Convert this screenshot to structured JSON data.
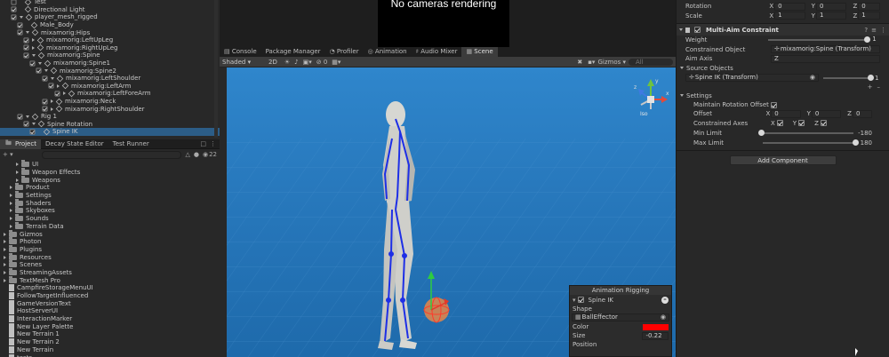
{
  "hierarchy": {
    "items": [
      {
        "label": "Test",
        "indent": 0,
        "check": false,
        "icon": "cube",
        "expand": "none"
      },
      {
        "label": "Directional Light",
        "indent": 0,
        "check": true,
        "icon": "cube",
        "expand": "none"
      },
      {
        "label": "player_mesh_rigged",
        "indent": 0,
        "check": true,
        "icon": "cube",
        "expand": "down"
      },
      {
        "label": "Male_Body",
        "indent": 1,
        "check": true,
        "icon": "cube",
        "expand": "none"
      },
      {
        "label": "mixamorig:Hips",
        "indent": 1,
        "check": true,
        "icon": "cube",
        "expand": "down"
      },
      {
        "label": "mixamorig:LeftUpLeg",
        "indent": 2,
        "check": true,
        "icon": "cube",
        "expand": "right"
      },
      {
        "label": "mixamorig:RightUpLeg",
        "indent": 2,
        "check": true,
        "icon": "cube",
        "expand": "right"
      },
      {
        "label": "mixamorig:Spine",
        "indent": 2,
        "check": true,
        "icon": "cube",
        "expand": "down"
      },
      {
        "label": "mixamorig:Spine1",
        "indent": 3,
        "check": true,
        "icon": "cube",
        "expand": "down"
      },
      {
        "label": "mixamorig:Spine2",
        "indent": 4,
        "check": true,
        "icon": "cube",
        "expand": "down"
      },
      {
        "label": "mixamorig:LeftShoulder",
        "indent": 5,
        "check": true,
        "icon": "cube",
        "expand": "down"
      },
      {
        "label": "mixamorig:LeftArm",
        "indent": 6,
        "check": true,
        "icon": "cube",
        "expand": "right"
      },
      {
        "label": "mixamorig:LeftForeArm",
        "indent": 7,
        "check": true,
        "icon": "cube",
        "expand": "right"
      },
      {
        "label": "mixamorig:Neck",
        "indent": 5,
        "check": true,
        "icon": "cube",
        "expand": "right"
      },
      {
        "label": "mixamorig:RightShoulder",
        "indent": 5,
        "check": true,
        "icon": "cube",
        "expand": "right"
      },
      {
        "label": "Rig 1",
        "indent": 1,
        "check": true,
        "icon": "cube",
        "expand": "down"
      },
      {
        "label": "Spine Rotation",
        "indent": 2,
        "check": true,
        "icon": "cube",
        "expand": "down"
      },
      {
        "label": "Spine IK",
        "indent": 3,
        "check": true,
        "icon": "cube",
        "expand": "none",
        "selected": true
      }
    ]
  },
  "project": {
    "tabs": [
      "Project",
      "Decay State Editor",
      "Test Runner"
    ],
    "count": "22",
    "items": [
      {
        "label": "UI",
        "indent": 1,
        "type": "folder"
      },
      {
        "label": "Weapon Effects",
        "indent": 1,
        "type": "folder"
      },
      {
        "label": "Weapons",
        "indent": 1,
        "type": "folder"
      },
      {
        "label": "Product",
        "indent": 0,
        "type": "folder"
      },
      {
        "label": "Settings",
        "indent": 0,
        "type": "folder"
      },
      {
        "label": "Shaders",
        "indent": 0,
        "type": "folder"
      },
      {
        "label": "Skyboxes",
        "indent": 0,
        "type": "folder"
      },
      {
        "label": "Sounds",
        "indent": 0,
        "type": "folder"
      },
      {
        "label": "Terrain Data",
        "indent": 0,
        "type": "folder"
      },
      {
        "label": "Gizmos",
        "indent": -1,
        "type": "folder"
      },
      {
        "label": "Photon",
        "indent": -1,
        "type": "folder"
      },
      {
        "label": "Plugins",
        "indent": -1,
        "type": "folder"
      },
      {
        "label": "Resources",
        "indent": -1,
        "type": "folder"
      },
      {
        "label": "Scenes",
        "indent": -1,
        "type": "folder"
      },
      {
        "label": "StreamingAssets",
        "indent": -1,
        "type": "folder"
      },
      {
        "label": "TextMesh Pro",
        "indent": -1,
        "type": "folder"
      },
      {
        "label": "CampfireStorageMenuUI",
        "indent": -1,
        "type": "file"
      },
      {
        "label": "FollowTargetInfluenced",
        "indent": -1,
        "type": "file"
      },
      {
        "label": "GameVersionText",
        "indent": -1,
        "type": "file"
      },
      {
        "label": "HostServerUI",
        "indent": -1,
        "type": "file"
      },
      {
        "label": "InteractionMarker",
        "indent": -1,
        "type": "file"
      },
      {
        "label": "New Layer Palette",
        "indent": -1,
        "type": "file"
      },
      {
        "label": "New Terrain 1",
        "indent": -1,
        "type": "file"
      },
      {
        "label": "New Terrain 2",
        "indent": -1,
        "type": "file"
      },
      {
        "label": "New Terrain",
        "indent": -1,
        "type": "file"
      },
      {
        "label": "tests",
        "indent": -1,
        "type": "file"
      }
    ]
  },
  "game_view": {
    "message": "No cameras rendering"
  },
  "scene": {
    "tabs": [
      "Console",
      "Package Manager",
      "Profiler",
      "Animation",
      "Audio Mixer",
      "Scene"
    ],
    "active_tab": "Scene",
    "shading": "Shaded",
    "mode_2d": "2D",
    "gizmos": "Gizmos",
    "search_placeholder": "All",
    "iso_label": "Iso",
    "gizmo_axes": {
      "y": "y",
      "x": "x",
      "z": "z"
    },
    "sky_color": "#2f7fc1"
  },
  "overlay": {
    "title": "Animation Rigging",
    "target": "Spine IK",
    "shape_label": "Shape",
    "shape_value": "BallEffector",
    "color_label": "Color",
    "color_value": "#ff0000",
    "size_label": "Size",
    "size_value": "-0.22",
    "position_label": "Position"
  },
  "inspector": {
    "rotation_label": "Rotation",
    "rotation": {
      "x": "0",
      "y": "0",
      "z": "0"
    },
    "scale_label": "Scale",
    "scale": {
      "x": "1",
      "y": "1",
      "z": "1"
    },
    "component_title": "Multi-Aim Constraint",
    "weight_label": "Weight",
    "weight_value": "1",
    "weight_fraction": 1.0,
    "constrained_object_label": "Constrained Object",
    "constrained_object_value": "mixamorig:Spine (Transform)",
    "aim_axis_label": "Aim Axis",
    "aim_axis_value": "Z",
    "source_objects_label": "Source Objects",
    "source_object_value": "Spine IK (Transform)",
    "source_weight": "1",
    "source_weight_fraction": 1.0,
    "settings_label": "Settings",
    "maintain_offset_label": "Maintain Rotation Offset",
    "offset_label": "Offset",
    "offset": {
      "x": "0",
      "y": "0",
      "z": "0"
    },
    "constrained_axes_label": "Constrained Axes",
    "axes": [
      "X",
      "Y",
      "Z"
    ],
    "min_limit_label": "Min Limit",
    "min_limit_value": "-180",
    "min_limit_fraction": 0.0,
    "max_limit_label": "Max Limit",
    "max_limit_value": "180",
    "max_limit_fraction": 1.0,
    "add_component_label": "Add Component",
    "axis_x": "X",
    "axis_y": "Y",
    "axis_z": "Z"
  }
}
